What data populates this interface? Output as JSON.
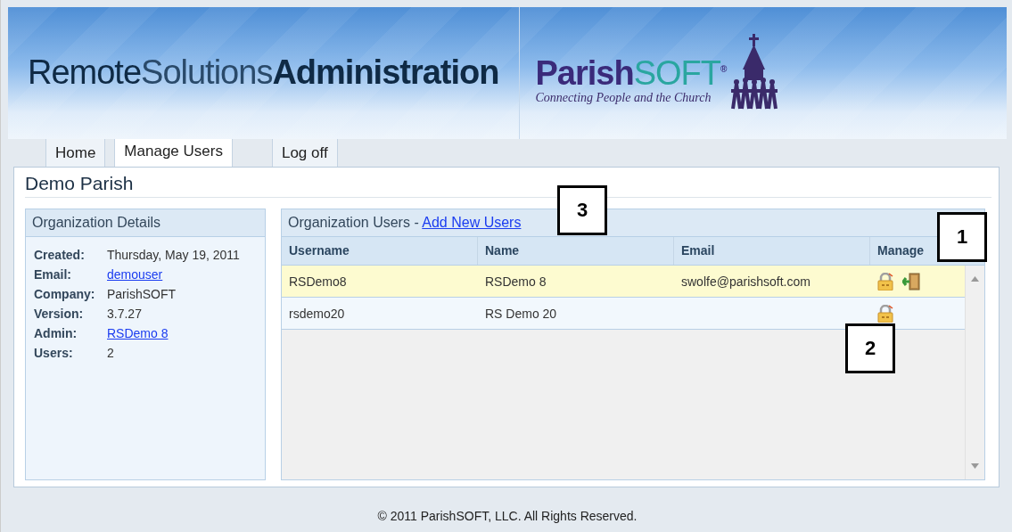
{
  "header": {
    "title": [
      {
        "text": "Remote",
        "kind": "regular"
      },
      {
        "text": "Solutions",
        "kind": "light"
      },
      {
        "text": "Administration",
        "kind": "bold"
      }
    ],
    "logo": {
      "brand": "Parish",
      "brand_suffix": "SOFT",
      "mark": "®",
      "tagline": "Connecting People and the Church"
    }
  },
  "tabs": [
    {
      "label": "Home",
      "selected": false
    },
    {
      "label": "Manage Users",
      "selected": true
    },
    {
      "label": "Log off",
      "selected": false
    }
  ],
  "page_title": "Demo Parish",
  "details": {
    "title": "Organization Details",
    "fields": [
      {
        "label": "Created:",
        "value": "Thursday, May 19, 2011",
        "kind": "text"
      },
      {
        "label": "Email:",
        "value": "demouser",
        "kind": "link"
      },
      {
        "label": "Company:",
        "value": "ParishSOFT",
        "kind": "text"
      },
      {
        "label": "Version:",
        "value": "3.7.27",
        "kind": "text"
      },
      {
        "label": "Admin:",
        "value": "RSDemo 8",
        "kind": "link"
      },
      {
        "label": "Users:",
        "value": "2",
        "kind": "text"
      }
    ]
  },
  "users": {
    "title": "Organization Users - ",
    "add_link": "Add New Users",
    "columns": [
      "Username",
      "Name",
      "Email",
      "Manage"
    ],
    "rows": [
      {
        "username": "RSDemo8",
        "name": "RSDemo 8",
        "email": "swolfe@parishsoft.com",
        "selected": true,
        "actions": [
          {
            "kind": "lock"
          },
          {
            "kind": "exit"
          }
        ]
      },
      {
        "username": "rsdemo20",
        "name": "RS Demo 20",
        "selected": false,
        "actions": [
          {
            "kind": "lock"
          }
        ]
      }
    ]
  },
  "callouts": [
    {
      "label": "3",
      "kind": "link"
    },
    {
      "label": "1",
      "kind": "header"
    },
    {
      "label": "2",
      "kind": "row"
    }
  ],
  "footer": "© 2011 ParishSOFT, LLC. All Rights Reserved."
}
